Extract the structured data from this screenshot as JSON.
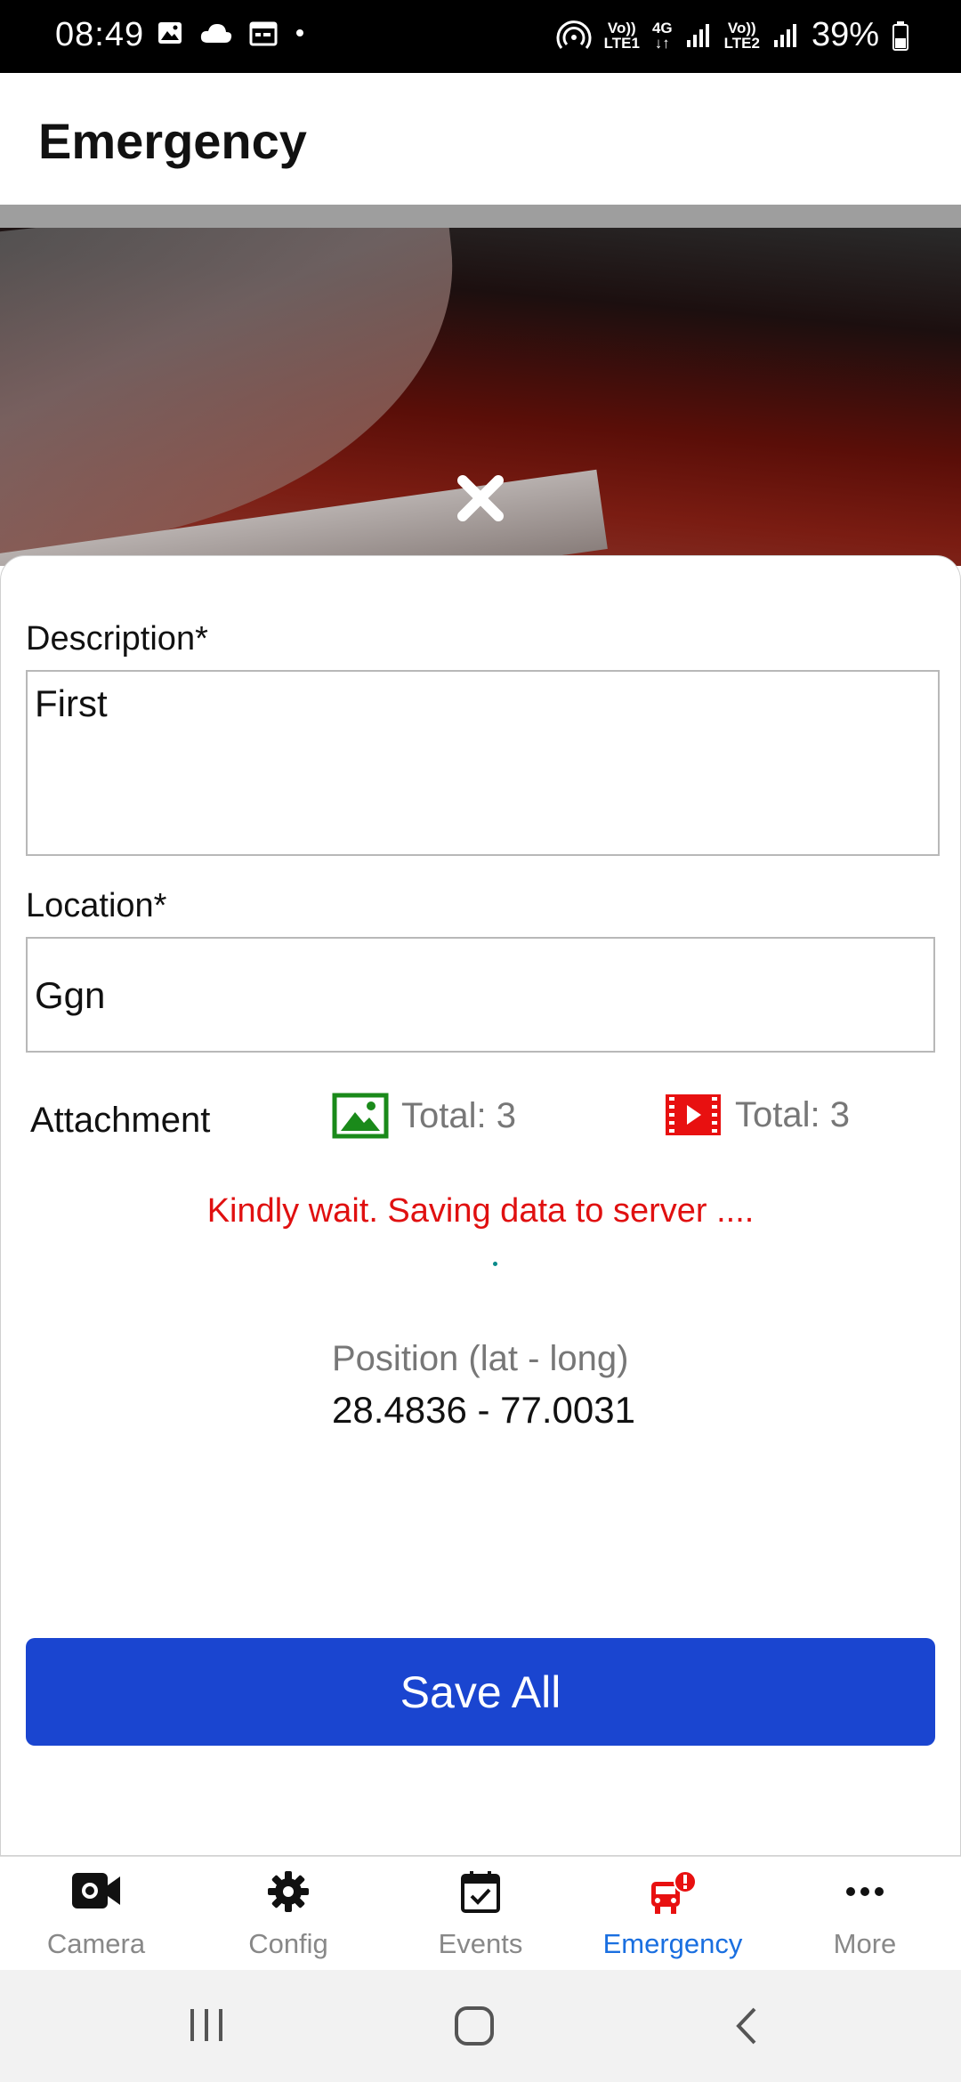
{
  "status_bar": {
    "time": "08:49",
    "battery": "39%",
    "sim1_label_top": "Vo))",
    "sim1_label_bottom": "LTE1",
    "network_label": "4G",
    "sim2_label_top": "Vo))",
    "sim2_label_bottom": "LTE2"
  },
  "appbar": {
    "title": "Emergency"
  },
  "form": {
    "description_label": "Description*",
    "description_value": "First",
    "location_label": "Location*",
    "location_value": "Ggn",
    "attachment_label": "Attachment",
    "images_total": "Total: 3",
    "videos_total": "Total: 3",
    "saving_message": "Kindly wait. Saving data to server ....",
    "position_label": "Position (lat - long)",
    "position_value": "28.4836 - 77.0031",
    "save_button": "Save All"
  },
  "bottom_nav": {
    "items": [
      {
        "label": "Camera",
        "icon": "video-camera-icon"
      },
      {
        "label": "Config",
        "icon": "gear-icon"
      },
      {
        "label": "Events",
        "icon": "calendar-check-icon"
      },
      {
        "label": "Emergency",
        "icon": "emergency-vehicle-alert-icon",
        "active": true
      },
      {
        "label": "More",
        "icon": "more-dots-icon"
      }
    ]
  },
  "colors": {
    "accent_blue": "#1a45d0",
    "active_nav": "#1a6fe0",
    "error_red": "#e01010",
    "image_icon_green": "#1a8a1a",
    "video_icon_red": "#e81010"
  }
}
